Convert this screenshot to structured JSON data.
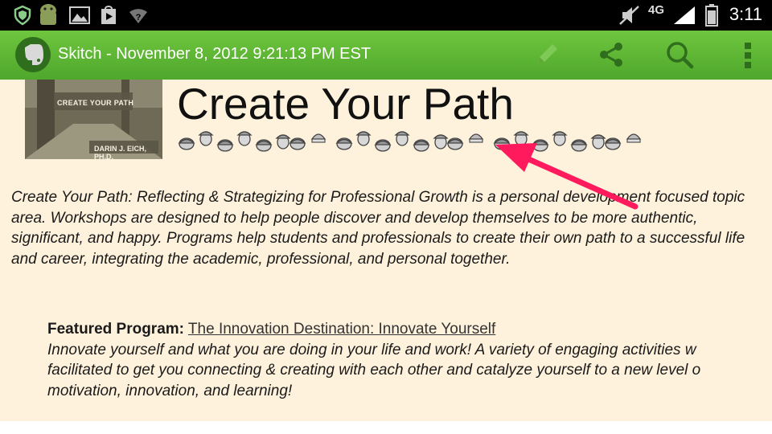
{
  "status_bar": {
    "time": "3:11",
    "network": "4G",
    "icons": [
      "shield-icon",
      "android-icon",
      "image-icon",
      "play-store-icon",
      "wifi-icon",
      "mute-icon",
      "signal-icon",
      "battery-icon"
    ]
  },
  "action_bar": {
    "title": "Skitch - November 8, 2012 9:21:13 PM EST",
    "actions": [
      "edit-icon",
      "share-icon",
      "search-icon",
      "overflow-menu-icon"
    ]
  },
  "page": {
    "photo_caption": "CREATE YOUR PATH",
    "photo_author": "DARIN J. EICH, PH.D.",
    "heading": "Create Your Path",
    "intro": "Create Your Path: Reflecting & Strategizing for Professional Growth is a personal development focused topic area. Workshops are designed to help people discover and develop themselves to be more authentic, significant, and happy. Programs help students and professionals to create their own path to a successful life and career, integrating the academic, professional, and personal together.",
    "featured_label": "Featured Program:",
    "featured_link": "The Innovation Destination: Innovate Yourself",
    "featured_line1": "Innovate yourself and what you are doing in your life and work!  A variety of engaging activities w",
    "featured_line2": "facilitated to get you connecting & creating with each other and catalyze yourself to a new level o",
    "featured_line3": "motivation, innovation, and learning!"
  },
  "colors": {
    "action_bar": "#5bb534",
    "page_background": "#fff2dc",
    "annotation_arrow": "#ff1a5e"
  }
}
